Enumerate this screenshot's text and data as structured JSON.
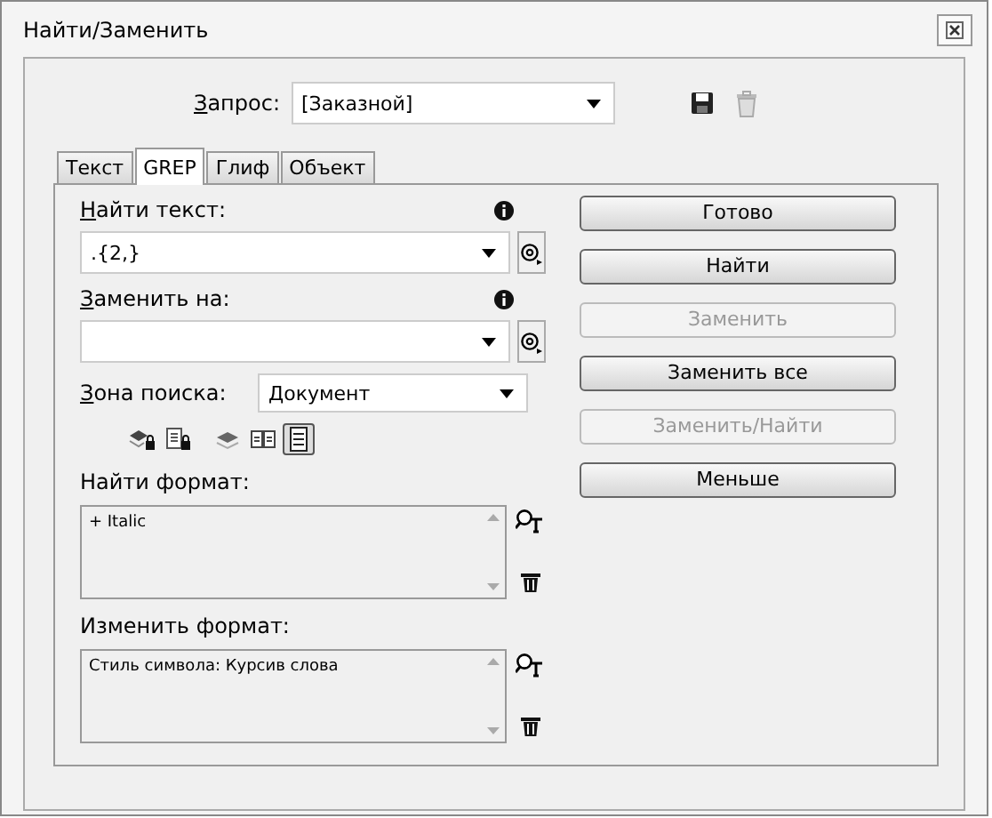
{
  "window": {
    "title": "Найти/Заменить"
  },
  "query": {
    "label": "Запрос:",
    "mnemonic": true,
    "value": "[Заказной]"
  },
  "tabs": [
    {
      "label": "Текст",
      "selected": false
    },
    {
      "label": "GREP",
      "selected": true
    },
    {
      "label": "Глиф",
      "selected": false
    },
    {
      "label": "Объект",
      "selected": false
    }
  ],
  "find_text": {
    "label": "Найти текст:",
    "mnemonic": true,
    "value": ".{2,}"
  },
  "replace_with": {
    "label": "Заменить на:",
    "mnemonic": true
  },
  "search_zone": {
    "label": "Зона поиска:",
    "mnemonic": true,
    "value": "Документ"
  },
  "search_options": [
    {
      "selected": false
    },
    {
      "selected": false
    },
    {
      "selected": false
    },
    {
      "selected": false
    },
    {
      "selected": true
    }
  ],
  "find_format": {
    "label": "Найти формат:",
    "text": "+ Italic"
  },
  "change_format": {
    "label": "Изменить формат:",
    "text": "Стиль символа: Курсив слова"
  },
  "buttons": [
    {
      "label": "Готово",
      "disabled": false
    },
    {
      "label": "Найти",
      "disabled": false
    },
    {
      "label": "Заменить",
      "disabled": true
    },
    {
      "label": "Заменить все",
      "disabled": false
    },
    {
      "label": "Заменить/Найти",
      "disabled": true
    },
    {
      "label": "Меньше",
      "disabled": false
    }
  ]
}
